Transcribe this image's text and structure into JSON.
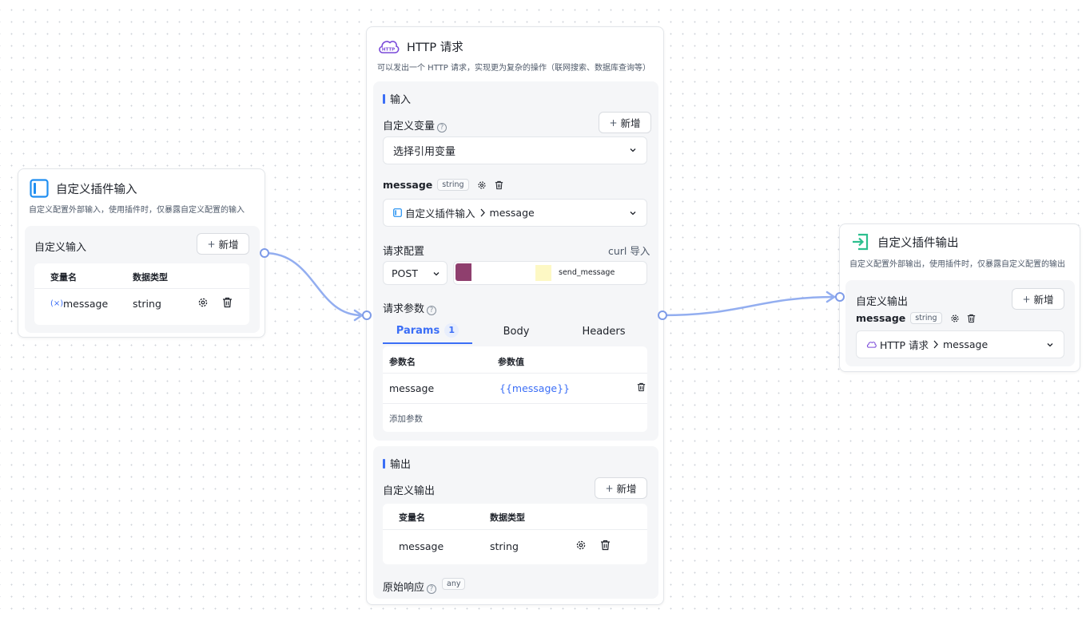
{
  "input_node": {
    "title": "自定义插件输入",
    "desc": "自定义配置外部输入，使用插件时，仅暴露自定义配置的输入",
    "section_label": "自定义输入",
    "add_label": "新增",
    "col_var": "变量名",
    "col_type": "数据类型",
    "rows": [
      {
        "name": "message",
        "type": "string"
      }
    ]
  },
  "http_node": {
    "title": "HTTP 请求",
    "desc": "可以发出一个 HTTP 请求，实现更为复杂的操作（联网搜索、数据库查询等）",
    "icon_text": "HTTP",
    "input_section": "输入",
    "custom_var_label": "自定义变量",
    "add_label": "新增",
    "select_placeholder": "选择引用变量",
    "var_name": "message",
    "var_type": "string",
    "var_source": "自定义插件输入",
    "var_source_field": "message",
    "request_config_label": "请求配置",
    "curl_import": "curl 导入",
    "method": "POST",
    "url_suffix": "send_message",
    "request_params_label": "请求参数",
    "tabs": [
      {
        "label": "Params",
        "badge": "1"
      },
      {
        "label": "Body",
        "badge": ""
      },
      {
        "label": "Headers",
        "badge": ""
      }
    ],
    "param_col_name": "参数名",
    "param_col_value": "参数值",
    "params": [
      {
        "name": "message",
        "value": "{{message}}"
      }
    ],
    "add_param": "添加参数",
    "output_section": "输出",
    "custom_output_label": "自定义输出",
    "out_col_var": "变量名",
    "out_col_type": "数据类型",
    "outputs": [
      {
        "name": "message",
        "type": "string"
      }
    ],
    "raw_response_label": "原始响应",
    "raw_response_type": "any"
  },
  "output_node": {
    "title": "自定义插件输出",
    "desc": "自定义配置外部输出，使用插件时，仅暴露自定义配置的输出",
    "section_label": "自定义输出",
    "add_label": "新增",
    "var_name": "message",
    "var_type": "string",
    "source_node": "HTTP 请求",
    "source_field": "message"
  },
  "colors": {
    "accent": "#3b6ef6",
    "edge": "#93aef0",
    "input_icon": "#1f8ef1",
    "http_icon": "#7a4ad9",
    "output_icon": "#2dbf8e",
    "url_block_1": "#8f3f6e",
    "url_block_2": "#fdf8c4"
  }
}
